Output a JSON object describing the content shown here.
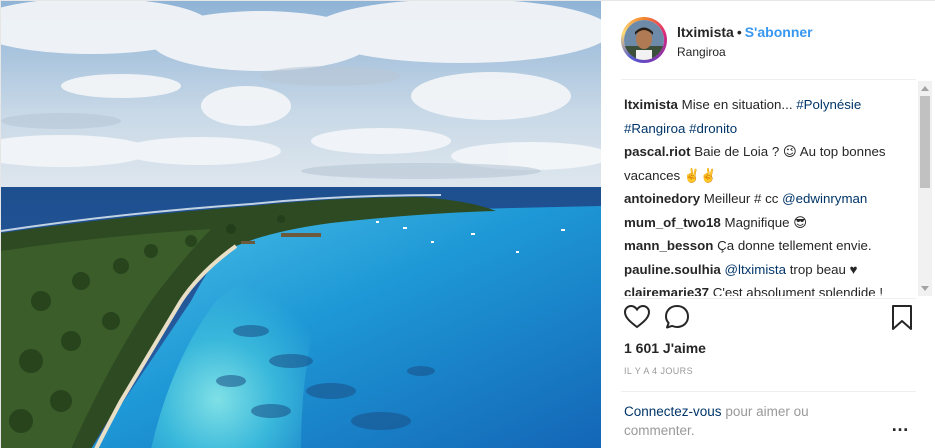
{
  "post": {
    "username": "ltximista",
    "separator": "•",
    "follow_label": "S'abonner",
    "location": "Rangiroa",
    "image_icon": "aerial-photo-atoll"
  },
  "comments": [
    {
      "user": "ltximista",
      "text": "Mise en situation... ",
      "tags": [
        "#Polynésie",
        "#Rangiroa",
        "#dronito"
      ]
    },
    {
      "user": "pascal.riot",
      "text": "Baie de Loia ? 😉 Au top bonnes vacances ✌️✌️"
    },
    {
      "user": "antoinedory",
      "text": "Meilleur # cc ",
      "mention": "@edwinryman"
    },
    {
      "user": "mum_of_two18",
      "text": "Magnifique 😎"
    },
    {
      "user": "mann_besson",
      "text": "Ça donne tellement envie."
    },
    {
      "user": "pauline.soulhia",
      "text": " trop beau ♥",
      "mention": "@ltximista"
    },
    {
      "user": "clairemarie37",
      "text": "C'est absolument splendide !"
    },
    {
      "user": "",
      "text": ""
    }
  ],
  "actions": {
    "like_icon": "heart-icon",
    "comment_icon": "comment-bubble-icon",
    "save_icon": "bookmark-icon"
  },
  "likes_label": "1 601 J'aime",
  "time_label": "IL Y A 4 JOURS",
  "login": {
    "link_label": "Connectez-vous",
    "rest_label": " pour aimer ou commenter."
  },
  "more_label": "…"
}
